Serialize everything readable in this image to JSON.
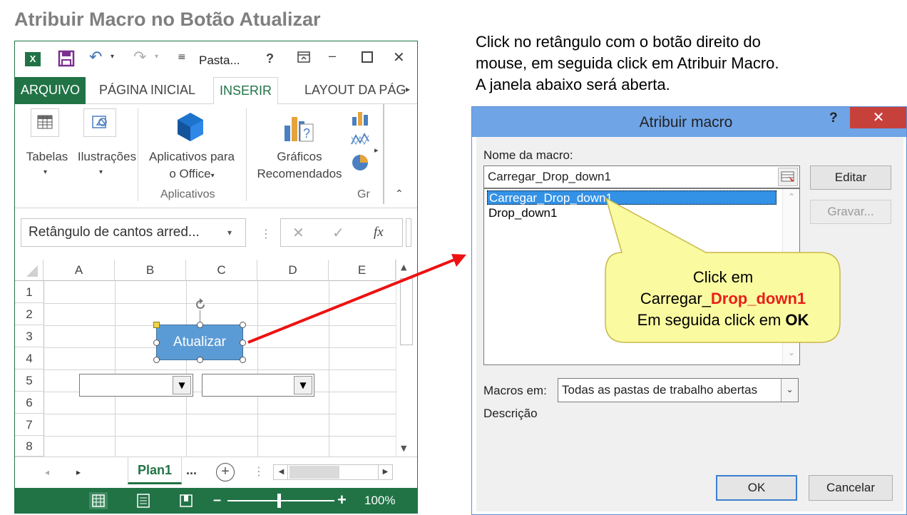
{
  "slide": {
    "title": "Atribuir Macro no Botão Atualizar",
    "instructions": [
      "Click no retângulo com o botão direito do",
      "mouse, em seguida click em Atribuir Macro.",
      "A janela abaixo será aberta."
    ]
  },
  "excel": {
    "window_title": "Pasta...",
    "tabs": [
      "ARQUIVO",
      "PÁGINA INICIAL",
      "INSERIR",
      "LAYOUT DA PÁG"
    ],
    "active_tab": "INSERIR",
    "ribbon": {
      "tabelas": "Tabelas",
      "ilustracoes": "Ilustrações",
      "apps_line1": "Aplicativos para",
      "apps_line2": "o Office",
      "graficos_line1": "Gráficos",
      "graficos_line2": "Recomendados",
      "group_aplicativos": "Aplicativos",
      "group_graficos": "Gr"
    },
    "name_box": "Retângulo de cantos arred...",
    "fx": "fx",
    "columns": [
      "A",
      "B",
      "C",
      "D",
      "E"
    ],
    "rows": [
      "1",
      "2",
      "3",
      "4",
      "5",
      "6",
      "7",
      "8"
    ],
    "shape_label": "Atualizar",
    "sheet_tab": "Plan1",
    "sheet_more": "...",
    "zoom": "100%"
  },
  "dialog": {
    "title": "Atribuir macro",
    "help": "?",
    "close": "✕",
    "macro_name_label": "Nome da macro:",
    "macro_name_value": "Carregar_Drop_down1",
    "macros": [
      "Carregar_Drop_down1",
      "Drop_down1"
    ],
    "selected_macro": "Carregar_Drop_down1",
    "edit_button": "Editar",
    "record_button": "Gravar...",
    "macros_in_label": "Macros em:",
    "macros_in_value": "Todas as pastas de trabalho abertas",
    "description_label": "Descrição",
    "ok_button": "OK",
    "cancel_button": "Cancelar"
  },
  "callout": {
    "line1": "Click em",
    "line2_prefix": "Carregar_",
    "line2_highlight": "Drop_down1",
    "line3_prefix": "Em seguida click em ",
    "line3_bold": "OK",
    "highlight_color": "#e8201a",
    "fill_color": "#fafaa0"
  },
  "colors": {
    "excel_green": "#217346",
    "shape_blue": "#5b9bd5",
    "dialog_title_blue": "#6fa4e6",
    "close_red": "#c7413b",
    "arrow_red": "#ee1111"
  }
}
